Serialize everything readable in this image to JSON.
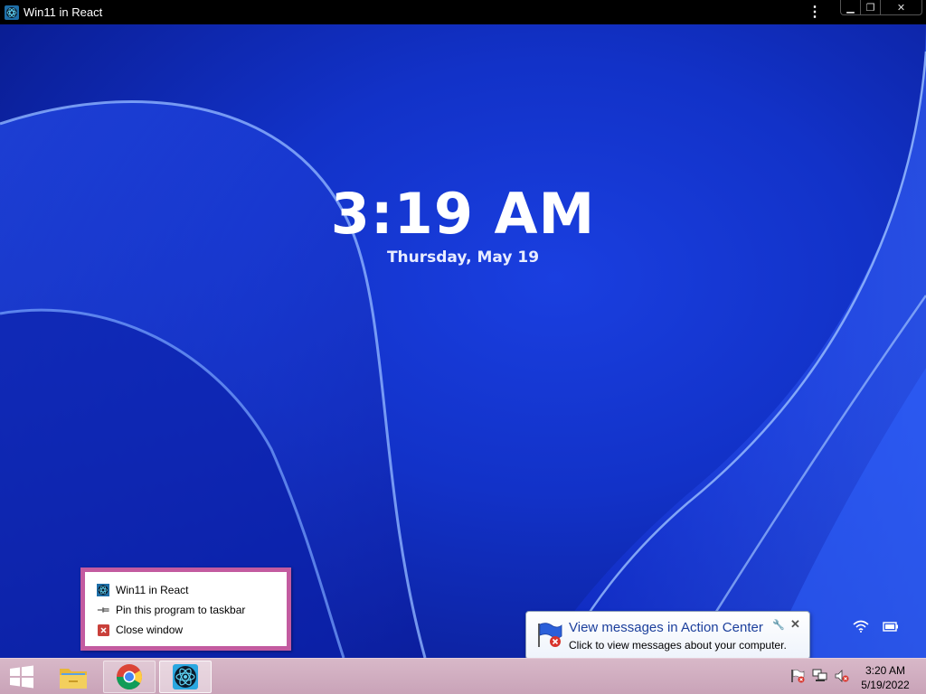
{
  "window": {
    "title": "Win11 in React",
    "menu_icon": "kebab-icon",
    "controls": [
      "minimize-icon",
      "restore-icon",
      "close-icon"
    ]
  },
  "lock_screen": {
    "time": "3:19 AM",
    "date": "Thursday, May 19"
  },
  "jump_list": {
    "items": [
      {
        "label": "Win11 in React",
        "icon": "react-app-icon"
      },
      {
        "label": "Pin this program to taskbar",
        "icon": "pin-icon"
      },
      {
        "label": "Close window",
        "icon": "close-window-icon"
      }
    ],
    "border_color": "#c35ba0"
  },
  "notification": {
    "title": "View messages in Action Center",
    "text": "Click to view messages about your computer.",
    "icon": "action-center-flag-icon"
  },
  "taskbar": {
    "apps": [
      {
        "name": "File Explorer",
        "icon": "folder-icon"
      },
      {
        "name": "Google Chrome",
        "icon": "chrome-icon"
      },
      {
        "name": "Win11 in React",
        "icon": "react-app-icon"
      }
    ],
    "clock_time": "3:20 AM",
    "clock_date": "5/19/2022",
    "color": "#c9a3b8"
  }
}
